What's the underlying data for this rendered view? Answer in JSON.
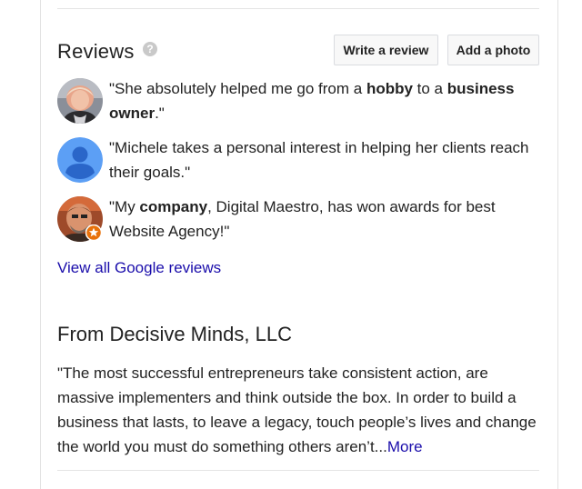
{
  "reviews": {
    "title": "Reviews",
    "help_icon": "?",
    "write_review_label": "Write a review",
    "add_photo_label": "Add a photo",
    "items": [
      {
        "parts": [
          "\"She absolutely helped me go from a ",
          "hobby",
          " to a ",
          "business owner",
          ".\""
        ],
        "avatar_icon": "photo-avatar-woman"
      },
      {
        "parts": [
          "\"Michele takes a personal interest in helping her clients reach their goals.\""
        ],
        "avatar_icon": "default-person-avatar"
      },
      {
        "parts": [
          "\"My ",
          "company",
          ", Digital Maestro, has won awards for best Website Agency!\""
        ],
        "avatar_icon": "photo-avatar-man-local-guide"
      }
    ],
    "view_all_label": "View all Google reviews"
  },
  "from_section": {
    "title": "From Decisive Minds, LLC",
    "text": "\"The most successful entrepreneurs take consistent action, are massive implementers and think outside the box. In order to build a business that lasts, to leave a legacy, touch people’s lives and change the world you must do something others aren’t...",
    "more_label": "More"
  },
  "colors": {
    "link": "#1a0dab",
    "default_avatar_bg": "#4285f4",
    "local_guide_badge": "#e8710a"
  }
}
